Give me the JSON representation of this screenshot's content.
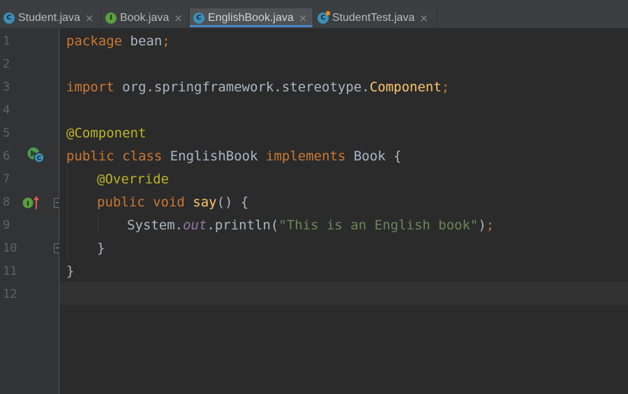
{
  "tabs": [
    {
      "label": "Student.java",
      "icon": "class-file-icon",
      "icon_letter": "C",
      "active": false
    },
    {
      "label": "Book.java",
      "icon": "interface-file-icon",
      "icon_letter": "I",
      "active": false
    },
    {
      "label": "EnglishBook.java",
      "icon": "class-file-icon",
      "icon_letter": "C",
      "active": true
    },
    {
      "label": "StudentTest.java",
      "icon": "test-class-file-icon",
      "icon_letter": "C",
      "active": false
    }
  ],
  "close_glyph": "×",
  "line_numbers": [
    "1",
    "2",
    "3",
    "4",
    "5",
    "6",
    "7",
    "8",
    "9",
    "10",
    "11",
    "12"
  ],
  "code": {
    "l1": {
      "kw": "package",
      "name": " bean",
      "semi": ";"
    },
    "l3": {
      "kw": "import",
      "path": " org.springframework.stereotype.",
      "cls": "Component",
      "semi": ";"
    },
    "l5": {
      "ann": "@Component"
    },
    "l6": {
      "kw1": "public",
      "kw2": " class",
      "name": " EnglishBook",
      "kw3": " implements",
      "iface": " Book",
      "brace": " {"
    },
    "l7": {
      "ann": "@Override"
    },
    "l8": {
      "kw1": "public",
      "kw2": " void",
      "method": " say",
      "rest": "() {"
    },
    "l9": {
      "obj": "System.",
      "field": "out",
      "call": ".println(",
      "str": "\"This is an English book\"",
      "close": ")",
      "semi": ";"
    },
    "l10": {
      "brace": "}"
    },
    "l11": {
      "brace": "}"
    }
  },
  "colors": {
    "keyword": "#cc7832",
    "annotation": "#bbb529",
    "string": "#6a8759",
    "method": "#ffc66d",
    "field": "#9876aa",
    "text": "#a9b7c6",
    "active_tab_underline": "#4a88c7"
  },
  "gutter_icons": {
    "line6": "run-class-icon",
    "line8": "implements-method-icon"
  }
}
